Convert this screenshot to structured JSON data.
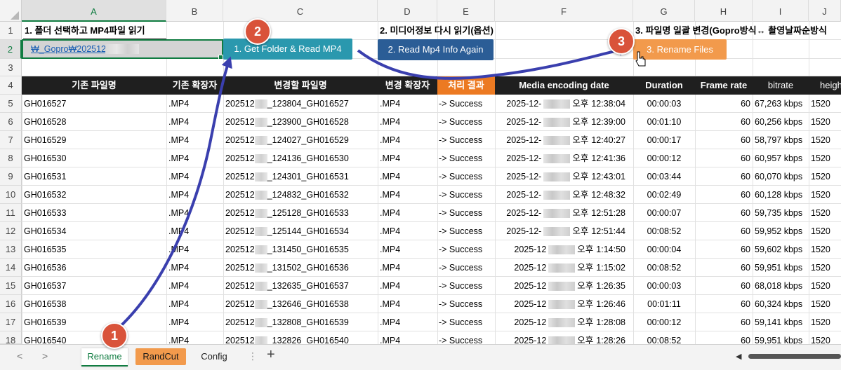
{
  "columns": [
    "A",
    "B",
    "C",
    "D",
    "E",
    "F",
    "G",
    "H",
    "I",
    "J"
  ],
  "rows": [
    "1",
    "2",
    "3",
    "4",
    "5",
    "6",
    "7",
    "8",
    "9",
    "10",
    "11",
    "12",
    "13",
    "14",
    "15",
    "16",
    "17",
    "18"
  ],
  "row1": {
    "a": "1. 폴더 선택하고 MP4파일 읽기",
    "d": "2. 미디어정보 다시 읽기(옵션)",
    "g": "3. 파일명 일괄 변경(Gopro방식↔ 촬영날짜순방식"
  },
  "row2": {
    "path": "₩_Gopro₩202512"
  },
  "buttons": {
    "get_folder": "1. Get Folder & Read MP4",
    "read_info": "2. Read Mp4 Info Again",
    "rename": "3. Rename Files"
  },
  "badges": [
    "1",
    "2",
    "3"
  ],
  "table_headers": [
    "기존 파일명",
    "기존 확장자",
    "변경할 파일명",
    "변경 확장자",
    "처리 결과",
    "Media encoding date",
    "Duration",
    "Frame rate",
    "bitrate",
    "heigh"
  ],
  "table_rows": [
    {
      "orig": "GH016527",
      "ext": ".MP4",
      "newp": "202512",
      "news": "_123804_GH016527",
      "next": ".MP4",
      "result": "-> Success",
      "datep": "2025-12-",
      "ampm": "오후",
      "time": "12:38:04",
      "dur": "00:00:03",
      "fps": "60",
      "bitrate": "67,263 kbps",
      "height": "1520"
    },
    {
      "orig": "GH016528",
      "ext": ".MP4",
      "newp": "202512",
      "news": "_123900_GH016528",
      "next": ".MP4",
      "result": "-> Success",
      "datep": "2025-12-",
      "ampm": "오후",
      "time": "12:39:00",
      "dur": "00:01:10",
      "fps": "60",
      "bitrate": "60,256 kbps",
      "height": "1520"
    },
    {
      "orig": "GH016529",
      "ext": ".MP4",
      "newp": "202512",
      "news": "_124027_GH016529",
      "next": ".MP4",
      "result": "-> Success",
      "datep": "2025-12-",
      "ampm": "오후",
      "time": "12:40:27",
      "dur": "00:00:17",
      "fps": "60",
      "bitrate": "58,797 kbps",
      "height": "1520"
    },
    {
      "orig": "GH016530",
      "ext": ".MP4",
      "newp": "202512",
      "news": "_124136_GH016530",
      "next": ".MP4",
      "result": "-> Success",
      "datep": "2025-12-",
      "ampm": "오후",
      "time": "12:41:36",
      "dur": "00:00:12",
      "fps": "60",
      "bitrate": "60,957 kbps",
      "height": "1520"
    },
    {
      "orig": "GH016531",
      "ext": ".MP4",
      "newp": "202512",
      "news": "_124301_GH016531",
      "next": ".MP4",
      "result": "-> Success",
      "datep": "2025-12-",
      "ampm": "오후",
      "time": "12:43:01",
      "dur": "00:03:44",
      "fps": "60",
      "bitrate": "60,070 kbps",
      "height": "1520"
    },
    {
      "orig": "GH016532",
      "ext": ".MP4",
      "newp": "202512",
      "news": "_124832_GH016532",
      "next": ".MP4",
      "result": "-> Success",
      "datep": "2025-12-",
      "ampm": "오후",
      "time": "12:48:32",
      "dur": "00:02:49",
      "fps": "60",
      "bitrate": "60,128 kbps",
      "height": "1520"
    },
    {
      "orig": "GH016533",
      "ext": ".MP4",
      "newp": "202512",
      "news": "_125128_GH016533",
      "next": ".MP4",
      "result": "-> Success",
      "datep": "2025-12-",
      "ampm": "오후",
      "time": "12:51:28",
      "dur": "00:00:07",
      "fps": "60",
      "bitrate": "59,735 kbps",
      "height": "1520"
    },
    {
      "orig": "GH016534",
      "ext": ".MP4",
      "newp": "202512",
      "news": "_125144_GH016534",
      "next": ".MP4",
      "result": "-> Success",
      "datep": "2025-12-",
      "ampm": "오후",
      "time": "12:51:44",
      "dur": "00:08:52",
      "fps": "60",
      "bitrate": "59,952 kbps",
      "height": "1520"
    },
    {
      "orig": "GH016535",
      "ext": ".MP4",
      "newp": "202512",
      "news": "_131450_GH016535",
      "next": ".MP4",
      "result": "-> Success",
      "datep": "2025-12",
      "ampm": "오후",
      "time": "1:14:50",
      "dur": "00:00:04",
      "fps": "60",
      "bitrate": "59,602 kbps",
      "height": "1520"
    },
    {
      "orig": "GH016536",
      "ext": ".MP4",
      "newp": "202512",
      "news": "_131502_GH016536",
      "next": ".MP4",
      "result": "-> Success",
      "datep": "2025-12",
      "ampm": "오후",
      "time": "1:15:02",
      "dur": "00:08:52",
      "fps": "60",
      "bitrate": "59,951 kbps",
      "height": "1520"
    },
    {
      "orig": "GH016537",
      "ext": ".MP4",
      "newp": "202512",
      "news": "_132635_GH016537",
      "next": ".MP4",
      "result": "-> Success",
      "datep": "2025-12",
      "ampm": "오후",
      "time": "1:26:35",
      "dur": "00:00:03",
      "fps": "60",
      "bitrate": "68,018 kbps",
      "height": "1520"
    },
    {
      "orig": "GH016538",
      "ext": ".MP4",
      "newp": "202512",
      "news": "_132646_GH016538",
      "next": ".MP4",
      "result": "-> Success",
      "datep": "2025-12",
      "ampm": "오후",
      "time": "1:26:46",
      "dur": "00:01:11",
      "fps": "60",
      "bitrate": "60,324 kbps",
      "height": "1520"
    },
    {
      "orig": "GH016539",
      "ext": ".MP4",
      "newp": "202512",
      "news": "_132808_GH016539",
      "next": ".MP4",
      "result": "-> Success",
      "datep": "2025-12",
      "ampm": "오후",
      "time": "1:28:08",
      "dur": "00:00:12",
      "fps": "60",
      "bitrate": "59,141 kbps",
      "height": "1520"
    },
    {
      "orig": "GH016540",
      "ext": ".MP4",
      "newp": "202512",
      "news": "_132826_GH016540",
      "next": ".MP4",
      "result": "-> Success",
      "datep": "2025-12",
      "ampm": "오후",
      "time": "1:28:26",
      "dur": "00:08:52",
      "fps": "60",
      "bitrate": "59,951 kbps",
      "height": "1520"
    }
  ],
  "tabs": [
    {
      "label": "Rename",
      "active": true
    },
    {
      "label": "RandCut",
      "active": false,
      "color": "#f29a4c"
    },
    {
      "label": "Config",
      "active": false
    }
  ],
  "tab_nav": {
    "prev": "<",
    "next": ">",
    "add": "+",
    "ellipsis": "⋮"
  },
  "colors": {
    "header_bg": "#1f1f1f",
    "result_header": "#ec7a22",
    "btn1": "#2a98ae",
    "btn2": "#2b5d96",
    "btn3": "#f29a4c",
    "badge": "#d9533a",
    "arrow": "#3a3fae",
    "excel_green": "#107c41"
  }
}
